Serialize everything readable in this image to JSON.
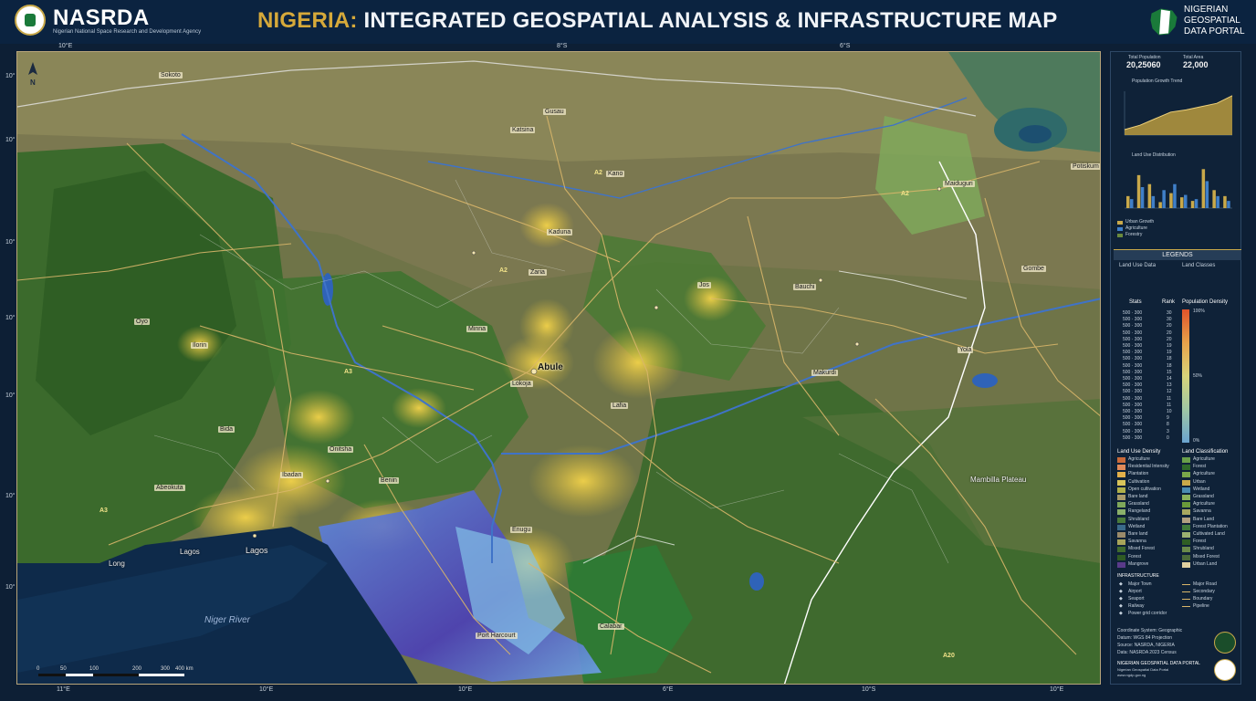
{
  "header": {
    "brand": "NASRDA",
    "brand_sub": "Nigerian National Space Research and Development Agency",
    "title_accent": "NIGERIA:",
    "title_rest": " INTEGRATED GEOSPATIAL ANALYSIS & INFRASTRUCTURE MAP",
    "portal_lines": [
      "NIGERIAN",
      "GEOSPATIAL",
      "DATA PORTAL"
    ]
  },
  "map": {
    "top_coords": [
      "10°E",
      "8°S",
      "6°S"
    ],
    "bottom_coords": [
      "11°E",
      "10°E",
      "10°E",
      "6°E",
      "10°S",
      "10°E"
    ],
    "left_coords": [
      "10°",
      "10°",
      "10°",
      "10°",
      "10°",
      "10°",
      "10°"
    ],
    "river_label": "Niger River",
    "north_label": "N",
    "place_labels": [
      {
        "t": "Abule",
        "big": true
      },
      {
        "t": "Lagos",
        "big": false
      },
      {
        "t": "Lagos",
        "big": false
      },
      {
        "t": "Ibadan"
      },
      {
        "t": "Sokoto"
      },
      {
        "t": "Kaduna"
      },
      {
        "t": "Kano"
      },
      {
        "t": "Jos"
      },
      {
        "t": "Maiduguri"
      },
      {
        "t": "Yola"
      },
      {
        "t": "Mambilla Plateau"
      },
      {
        "t": "Benin"
      },
      {
        "t": "Onitsha"
      },
      {
        "t": "Enugu"
      },
      {
        "t": "Makurdi"
      },
      {
        "t": "Lokoja"
      },
      {
        "t": "Ilorin"
      },
      {
        "t": "Oyo"
      },
      {
        "t": "Abeokuta"
      },
      {
        "t": "Port Harcourt"
      },
      {
        "t": "Calabar"
      },
      {
        "t": "Bauchi"
      },
      {
        "t": "Gombe"
      },
      {
        "t": "Zaria"
      },
      {
        "t": "Minna"
      },
      {
        "t": "Bida"
      },
      {
        "t": "Katsina"
      },
      {
        "t": "Gusau"
      },
      {
        "t": "Potiskum"
      },
      {
        "t": "Lafia"
      },
      {
        "t": "A3"
      },
      {
        "t": "A2"
      },
      {
        "t": "A3"
      },
      {
        "t": "A2"
      },
      {
        "t": "A2"
      },
      {
        "t": "A20"
      },
      {
        "t": "Long"
      }
    ],
    "scale": [
      "0",
      "50",
      "100",
      "200",
      "300",
      "400 km"
    ]
  },
  "panel": {
    "stat1": "20,25060",
    "stat1_label": "Total Population",
    "stat2": "22,000",
    "stat2_label": "Total Area",
    "line_title": "Population Growth Trend",
    "bar_title": "Land Use Distribution",
    "bar_legend": [
      "Urban Growth",
      "Agriculture",
      "Forestry"
    ],
    "legends_title": "LEGENDS",
    "leg_cols": [
      "Land Use Data",
      "Land Classes"
    ],
    "table_head": [
      "Stats",
      "Rank"
    ],
    "table_rows": [
      [
        "500 · 300",
        "30"
      ],
      [
        "500 · 300",
        "30"
      ],
      [
        "500 · 300",
        "20"
      ],
      [
        "500 · 300",
        "20"
      ],
      [
        "500 · 300",
        "20"
      ],
      [
        "500 · 300",
        "19"
      ],
      [
        "500 · 300",
        "19"
      ],
      [
        "500 · 300",
        "18"
      ],
      [
        "500 · 300",
        "18"
      ],
      [
        "500 · 300",
        "15"
      ],
      [
        "500 · 300",
        "14"
      ],
      [
        "500 · 300",
        "13"
      ],
      [
        "500 · 300",
        "12"
      ],
      [
        "500 · 300",
        "11"
      ],
      [
        "500 · 300",
        "11"
      ],
      [
        "500 · 300",
        "10"
      ],
      [
        "500 · 300",
        "9"
      ],
      [
        "500 · 300",
        "8"
      ],
      [
        "500 · 300",
        "3"
      ],
      [
        "500 · 300",
        "0"
      ]
    ],
    "density_title": "Population Density",
    "density_ticks": [
      "100%",
      "50%",
      "0%"
    ],
    "landuse_title": "Land Use Density",
    "landclass_title": "Land Classification",
    "landuse_items": [
      "Agriculture",
      "Residential Intensity",
      "Plantation",
      "Cultivation",
      "Open cultivation",
      "Bare land",
      "Grassland",
      "Rangeland",
      "Shrubland",
      "Wetland",
      "Bare land",
      "Savanna",
      "Mixed Forest",
      "Forest",
      "Mangrove"
    ],
    "landclass_items": [
      "Agriculture",
      "Forest",
      "Agriculture",
      "Urban",
      "Wetland",
      "Grassland",
      "Agriculture",
      "Savanna",
      "Bare Land",
      "Forest Plantation",
      "Cultivated Land",
      "Forest",
      "Shrubland",
      "Mixed Forest",
      "Urban Land"
    ],
    "infra_title": "INFRASTRUCTURE",
    "infra_items": [
      "Major Town",
      "Airport",
      "Seaport",
      "Railway",
      "Power grid corridor"
    ],
    "infra_items2": [
      "Major Road",
      "Secondary",
      "Boundary",
      "Pipeline"
    ],
    "footer_lines": [
      "Coordinate System: Geographic",
      "Datum: WGS 84 Projection",
      "Source: NASRDA, NIGERIA",
      "Data: NASRDA 2023 Census"
    ],
    "footer_portal": "NIGERIAN GEOSPATIAL DATA PORTAL",
    "footer_sub": [
      "Nigerian Geospatial Data Portal",
      "www.ngdp.gov.ng"
    ]
  },
  "colors": {
    "header_bg": "#0b2340",
    "accent_gold": "#d6a93a",
    "forest": "#2f6a2a",
    "savanna": "#8a8a4e",
    "urban": "#e3c13c",
    "wetland": "#5b5fd8",
    "ocean": "#0e2a4a"
  },
  "chart_data": [
    {
      "type": "area",
      "title": "Population Growth Trend",
      "x": [
        1,
        2,
        3,
        4,
        5,
        6,
        7,
        8
      ],
      "values": [
        10,
        18,
        30,
        42,
        46,
        52,
        58,
        72
      ],
      "ylim": [
        0,
        80
      ]
    },
    {
      "type": "bar",
      "title": "Land Use Distribution",
      "categories": [
        "1",
        "2",
        "3",
        "4",
        "5",
        "6",
        "7",
        "8",
        "9",
        "10"
      ],
      "series": [
        {
          "name": "Urban Growth",
          "values": [
            20,
            55,
            40,
            10,
            25,
            18,
            12,
            65,
            30,
            20
          ]
        },
        {
          "name": "Agriculture",
          "values": [
            15,
            35,
            20,
            30,
            40,
            22,
            15,
            45,
            20,
            12
          ]
        }
      ],
      "ylim": [
        0,
        70
      ]
    }
  ]
}
